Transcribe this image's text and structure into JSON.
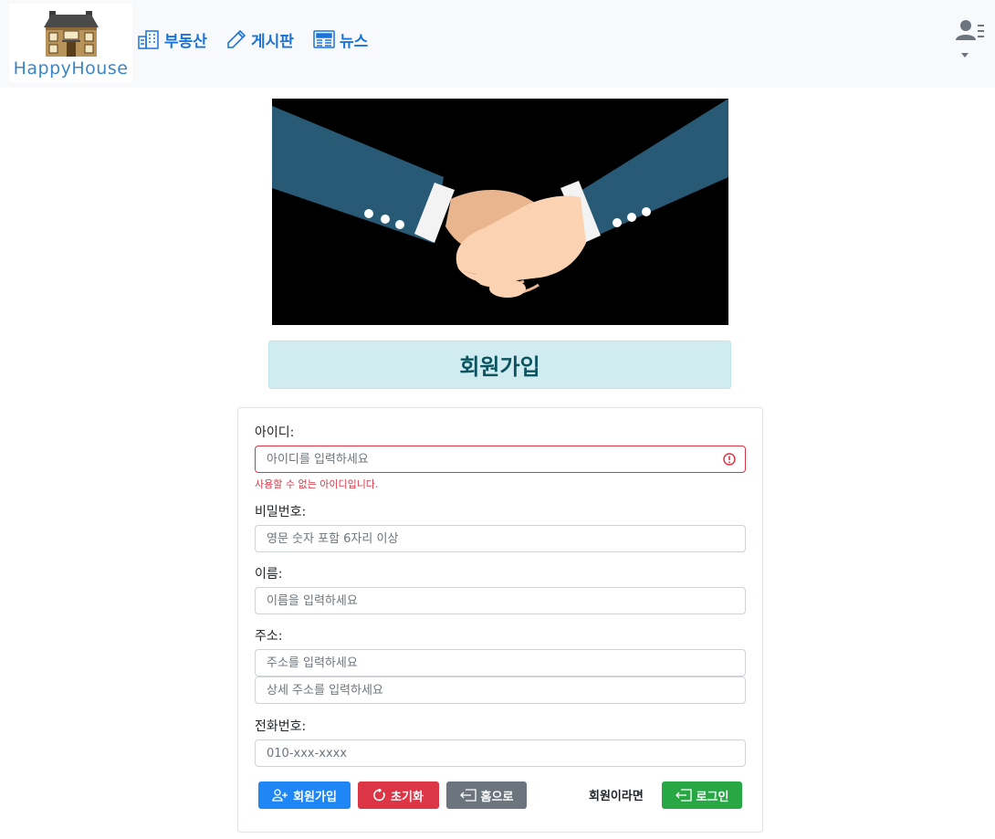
{
  "brand": {
    "name": "HappyHouse"
  },
  "nav": {
    "items": [
      {
        "label": "부동산",
        "icon": "buildings-icon"
      },
      {
        "label": "게시판",
        "icon": "pencil-icon"
      },
      {
        "label": "뉴스",
        "icon": "newspaper-icon"
      }
    ],
    "user_menu_icon": "user-list-icon",
    "accent": "#1a73d9"
  },
  "hero": {
    "image": "handshake-illustration"
  },
  "page_title": "회원가입",
  "form": {
    "id": {
      "label": "아이디:",
      "placeholder": "아이디를 입력하세요",
      "value": "",
      "error": "사용할 수 없는 아이디입니다."
    },
    "password": {
      "label": "비밀번호:",
      "placeholder": "영문 숫자 포함 6자리 이상",
      "value": ""
    },
    "name": {
      "label": "이름:",
      "placeholder": "이름을 입력하세요",
      "value": ""
    },
    "address": {
      "label": "주소:",
      "placeholder": "주소를 입력하세요",
      "detail_placeholder": "상세 주소를 입력하세요",
      "value": "",
      "detail_value": ""
    },
    "phone": {
      "label": "전화번호:",
      "placeholder": "010-xxx-xxxx",
      "value": ""
    }
  },
  "buttons": {
    "signup": "회원가입",
    "reset": "초기화",
    "home": "홈으로",
    "member_prompt": "회원이라면",
    "login": "로그인"
  },
  "colors": {
    "primary": "#1f87f5",
    "danger": "#dc3545",
    "secondary": "#6c757d",
    "success": "#28a745",
    "title_bg": "#d1ecf1",
    "title_text": "#0c5460"
  }
}
